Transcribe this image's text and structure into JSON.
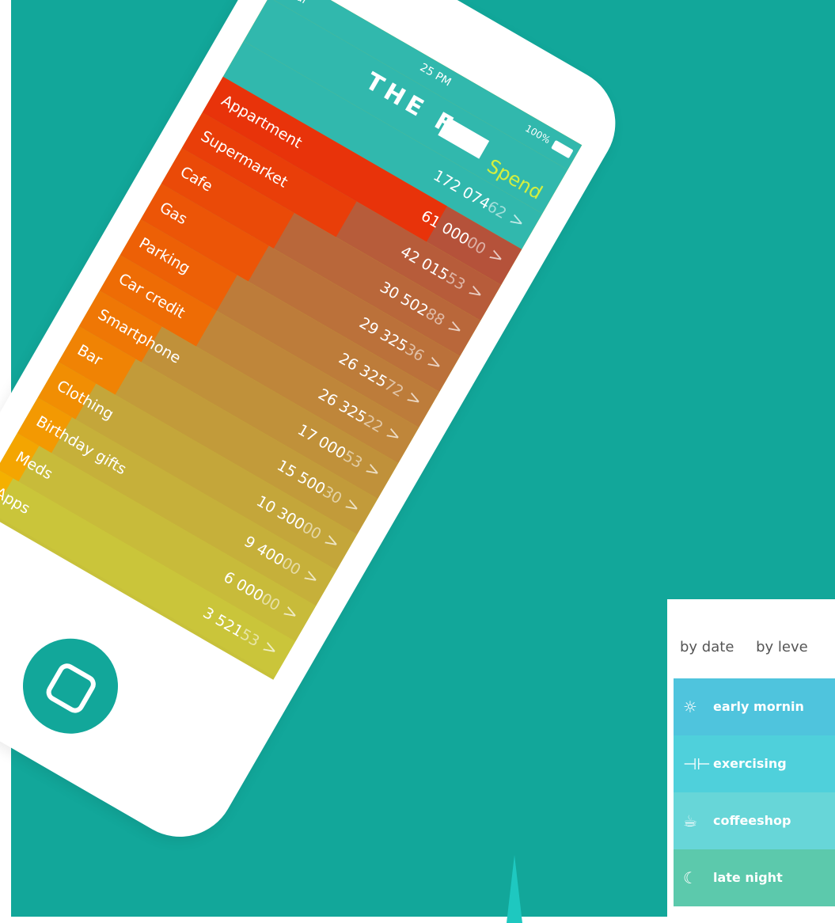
{
  "phone": {
    "status_bar": {
      "left_text": "Total",
      "time": "25 PM",
      "battery": "100%"
    },
    "header": {
      "title": "THE F",
      "mode": "Spend"
    },
    "total": {
      "integer": "172 074",
      "cents": "62",
      "chevron": ">"
    },
    "rows": [
      {
        "label": "Appartment",
        "integer": "61 000",
        "cents": "00",
        "chevron": ">"
      },
      {
        "label": "Supermarket",
        "integer": "42 015",
        "cents": "53",
        "chevron": ">"
      },
      {
        "label": "Cafe",
        "integer": "30 502",
        "cents": "88",
        "chevron": ">"
      },
      {
        "label": "Gas",
        "integer": "29 325",
        "cents": "36",
        "chevron": ">"
      },
      {
        "label": "Parking",
        "integer": "26 325",
        "cents": "72",
        "chevron": ">"
      },
      {
        "label": "Car credit",
        "integer": "26 325",
        "cents": "22",
        "chevron": ">"
      },
      {
        "label": "Smartphone",
        "integer": "17 000",
        "cents": "53",
        "chevron": ">"
      },
      {
        "label": "Bar",
        "integer": "15 500",
        "cents": "30",
        "chevron": ">"
      },
      {
        "label": "Clothing",
        "integer": "10 300",
        "cents": "00",
        "chevron": ">"
      },
      {
        "label": "Birthday gifts",
        "integer": "9 400",
        "cents": "00",
        "chevron": ">"
      },
      {
        "label": "Meds",
        "integer": "6 000",
        "cents": "00",
        "chevron": ">"
      },
      {
        "label": "Apps",
        "integer": "3 521",
        "cents": "53",
        "chevron": ">"
      }
    ]
  },
  "card": {
    "filters": [
      "by date",
      "by leve"
    ],
    "items": [
      {
        "icon": "sun-icon",
        "label": "early mornin"
      },
      {
        "icon": "dumbbell-icon",
        "label": "exercising"
      },
      {
        "icon": "coffee-cup-icon",
        "label": "coffeeshop"
      },
      {
        "icon": "moon-icon",
        "label": "late night"
      }
    ]
  },
  "colors": {
    "background": "#12a79a",
    "header": "#31b8ad",
    "spend": "#d4ef3f",
    "bar_top": "#e8330a",
    "bar_bottom": "#f5b000",
    "row_bg_top": "#b5523a",
    "row_bg_bottom": "#cac53a",
    "card_item_1": "#4fc4dd",
    "card_item_2": "#4fd0db",
    "card_item_3": "#67d6d8",
    "card_item_4": "#5cc9ac"
  }
}
